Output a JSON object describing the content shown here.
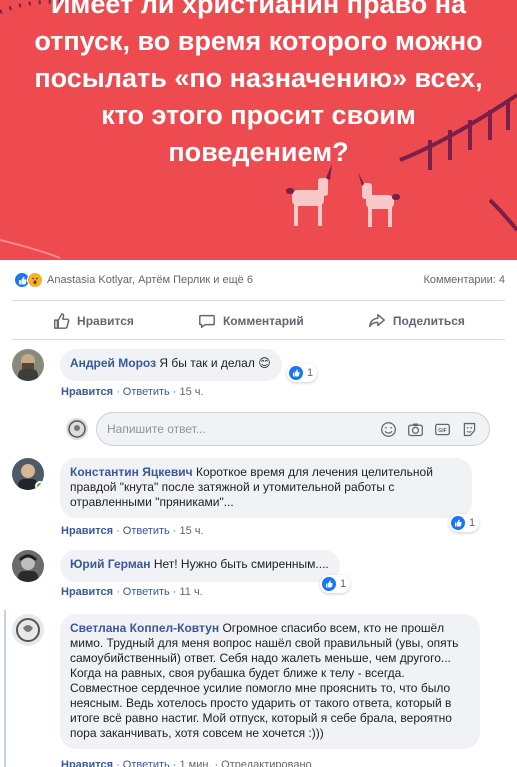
{
  "post": {
    "banner_text": "Имеет ли христианин право на отпуск, во время которого можно посылать «по назначению» всех, кто этого просит своим поведением?",
    "banner_color": "#ee4b50"
  },
  "reactions": {
    "reactors": "Anastasia Kotlyar, Артём Перлик и ещё 6",
    "comments_count": "Комментарии: 4"
  },
  "actions": {
    "like": "Нравится",
    "comment": "Комментарий",
    "share": "Поделиться"
  },
  "comments": [
    {
      "author": "Андрей Мороз",
      "text": "Я бы так и делал",
      "emoji": "😊",
      "like_label": "Нравится",
      "reply_label": "Ответить",
      "time": "15 ч.",
      "likes": "1"
    },
    {
      "author": "Константин Яцкевич",
      "text": "Короткое время для лечения целительной правдой \"кнута\" после затяжной и утомительной работы с отравленными \"пряниками\"...",
      "like_label": "Нравится",
      "reply_label": "Ответить",
      "time": "15 ч.",
      "likes": "1"
    },
    {
      "author": "Юрий Герман",
      "text": "Нет! Нужно быть смиренным....",
      "like_label": "Нравится",
      "reply_label": "Ответить",
      "time": "11 ч.",
      "likes": "1"
    },
    {
      "author": "Светлана Коппел-Ковтун",
      "text": "Огромное спасибо всем, кто не прошёл мимо. Трудный для меня вопрос нашёл свой правильный (увы, опять самоубийственный) ответ. Себя надо жалеть меньше, чем другого... Когда на равных, своя рубашка будет ближе к телу - всегда. Совместное сердечное усилие помогло мне прояснить то, что было неясным. Ведь хотелось просто ударить от такого ответа, который в итоге всё равно настиг. Мой отпуск, который я себе брала, вероятно пора заканчивать, хотя совсем не хочется :)))",
      "like_label": "Нравится",
      "reply_label": "Ответить",
      "time": "1 мин.",
      "edited": "Отредактировано"
    }
  ],
  "reply_box": {
    "placeholder": "Напишите ответ..."
  },
  "colors": {
    "link": "#385898",
    "like_blue": "#1877f2",
    "bubble_bg": "#f0f2f5"
  }
}
